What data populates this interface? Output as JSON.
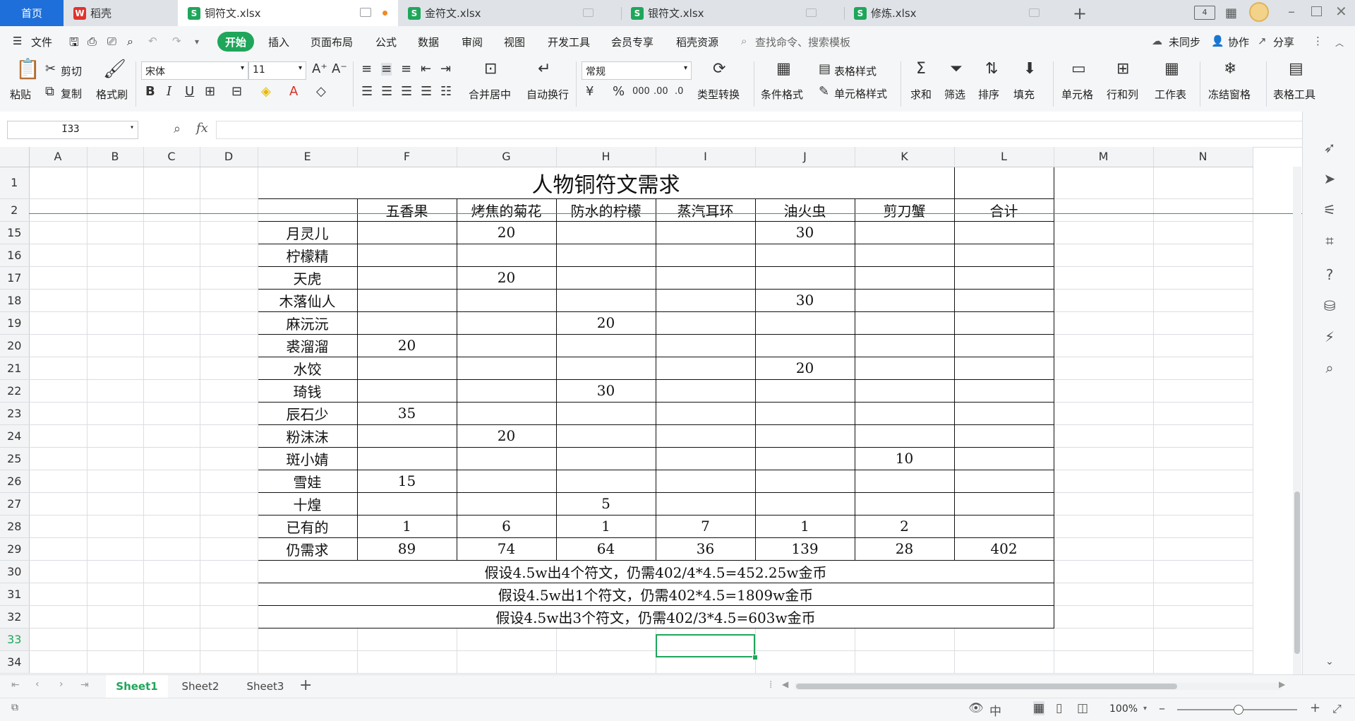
{
  "tabs": [
    {
      "label": "首页",
      "active": false,
      "color": "#1e6fd9"
    },
    {
      "label": "稻壳",
      "active": false,
      "color": "#e0332c"
    },
    {
      "label": "铜符文.xlsx",
      "active": true,
      "color": "#1fa65a"
    },
    {
      "label": "金符文.xlsx",
      "active": false,
      "color": "#1fa65a"
    },
    {
      "label": "银符文.xlsx",
      "active": false,
      "color": "#1fa65a"
    },
    {
      "label": "修炼.xlsx",
      "active": false,
      "color": "#1fa65a"
    }
  ],
  "menu": {
    "file": "文件",
    "start": "开始",
    "items": [
      "插入",
      "页面布局",
      "公式",
      "数据",
      "审阅",
      "视图",
      "开发工具",
      "会员专享",
      "稻壳资源"
    ],
    "search_placeholder": "查找命令、搜索模板",
    "sync": "未同步",
    "collab": "协作",
    "share": "分享"
  },
  "ribbon": {
    "paste": "粘贴",
    "cut": "剪切",
    "copy": "复制",
    "format_painter": "格式刷",
    "font_name": "宋体",
    "font_size": "11",
    "merge_center": "合并居中",
    "wrap": "自动换行",
    "number_format": "常规",
    "type_convert": "类型转换",
    "cond_format": "条件格式",
    "table_style": "表格样式",
    "cell_style": "单元格样式",
    "sum": "求和",
    "filter": "筛选",
    "sort": "排序",
    "fill": "填充",
    "cell": "单元格",
    "row_col": "行和列",
    "worksheet": "工作表",
    "freeze": "冻结窗格",
    "table_tools": "表格工具"
  },
  "formula_bar": {
    "name_box": "I33",
    "fx": "fx",
    "content": ""
  },
  "colors": {
    "accent": "#1fa65a",
    "tabbar": "#dfe3e8",
    "header": "#f3f4f5"
  },
  "sheet": {
    "columns": [
      "A",
      "B",
      "C",
      "D",
      "E",
      "F",
      "G",
      "H",
      "I",
      "J",
      "K",
      "L",
      "M",
      "N"
    ],
    "selected_column": "I",
    "selected_row": "33",
    "title": "人物铜符文需求",
    "headers": [
      "五香果",
      "烤焦的菊花",
      "防水的柠檬",
      "蒸汽耳环",
      "油火虫",
      "剪刀蟹",
      "合计"
    ],
    "rows": [
      {
        "num": "15",
        "name": "月灵儿",
        "v": [
          "",
          "20",
          "",
          "",
          "30",
          "",
          ""
        ]
      },
      {
        "num": "16",
        "name": "柠檬精",
        "v": [
          "",
          "",
          "",
          "",
          "",
          "",
          ""
        ]
      },
      {
        "num": "17",
        "name": "天虎",
        "v": [
          "",
          "20",
          "",
          "",
          "",
          "",
          ""
        ]
      },
      {
        "num": "18",
        "name": "木落仙人",
        "v": [
          "",
          "",
          "",
          "",
          "30",
          "",
          ""
        ]
      },
      {
        "num": "19",
        "name": "麻沅沅",
        "v": [
          "",
          "",
          "20",
          "",
          "",
          "",
          ""
        ]
      },
      {
        "num": "20",
        "name": "裘溜溜",
        "v": [
          "20",
          "",
          "",
          "",
          "",
          "",
          ""
        ]
      },
      {
        "num": "21",
        "name": "水饺",
        "v": [
          "",
          "",
          "",
          "",
          "20",
          "",
          ""
        ]
      },
      {
        "num": "22",
        "name": "琦钱",
        "v": [
          "",
          "",
          "30",
          "",
          "",
          "",
          ""
        ]
      },
      {
        "num": "23",
        "name": "辰石少",
        "v": [
          "35",
          "",
          "",
          "",
          "",
          "",
          ""
        ]
      },
      {
        "num": "24",
        "name": "粉沫沫",
        "v": [
          "",
          "20",
          "",
          "",
          "",
          "",
          ""
        ]
      },
      {
        "num": "25",
        "name": "斑小婧",
        "v": [
          "",
          "",
          "",
          "",
          "",
          "10",
          ""
        ]
      },
      {
        "num": "26",
        "name": "雪娃",
        "v": [
          "15",
          "",
          "",
          "",
          "",
          "",
          ""
        ]
      },
      {
        "num": "27",
        "name": "十煌",
        "v": [
          "",
          "",
          "5",
          "",
          "",
          "",
          ""
        ]
      },
      {
        "num": "28",
        "name": "已有的",
        "v": [
          "1",
          "6",
          "1",
          "7",
          "1",
          "2",
          ""
        ]
      },
      {
        "num": "29",
        "name": "仍需求",
        "v": [
          "89",
          "74",
          "64",
          "36",
          "139",
          "28",
          "402"
        ]
      }
    ],
    "notes": [
      {
        "num": "30",
        "text": "假设4.5w出4个符文，仍需402/4*4.5=452.25w金币"
      },
      {
        "num": "31",
        "text": "假设4.5w出1个符文，仍需402*4.5=1809w金币"
      },
      {
        "num": "32",
        "text": "假设4.5w出3个符文，仍需402/3*4.5=603w金币"
      }
    ],
    "tail_rows": [
      "33",
      "34"
    ]
  },
  "sheet_tabs": [
    "Sheet1",
    "Sheet2",
    "Sheet3"
  ],
  "status": {
    "zoom": "100%"
  }
}
